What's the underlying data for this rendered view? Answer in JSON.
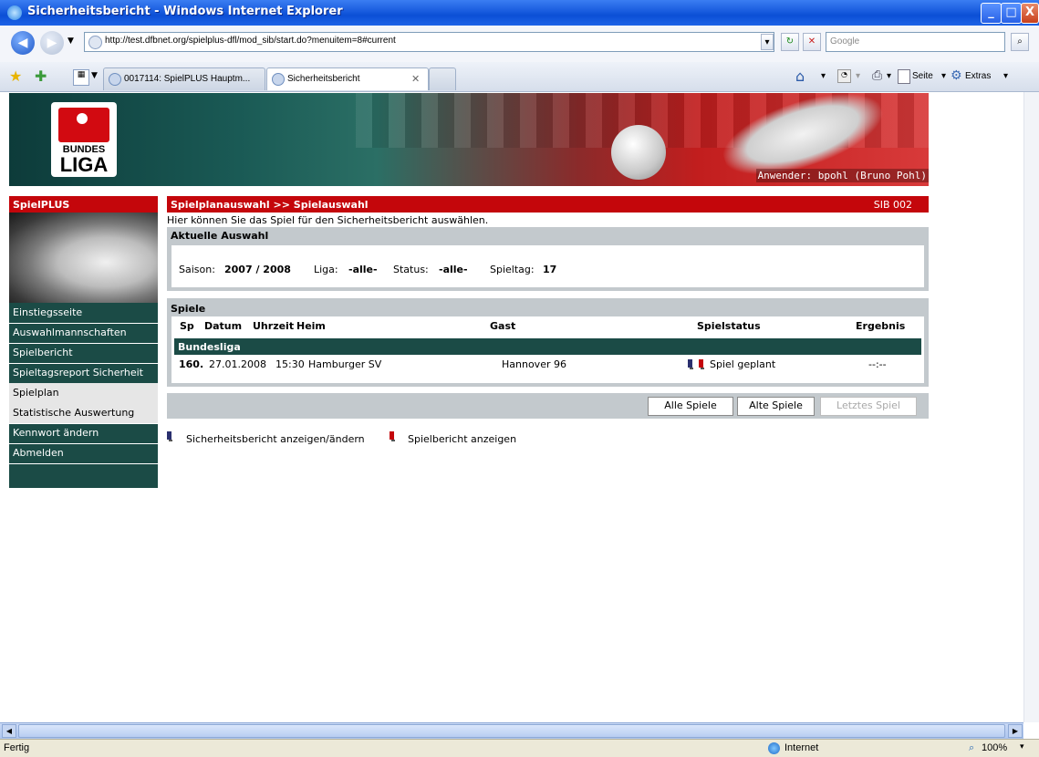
{
  "window": {
    "title": "Sicherheitsbericht - Windows Internet Explorer",
    "controls": {
      "minimize": "_",
      "maximize": "□",
      "close": "X"
    }
  },
  "addressbar": {
    "url": "http://test.dfbnet.org/spielplus-dfl/mod_sib/start.do?menuitem=8#current",
    "search_placeholder": "Google"
  },
  "tabs": [
    {
      "label": "0017114: SpielPLUS Hauptm...",
      "active": false
    },
    {
      "label": "Sicherheitsbericht",
      "active": true
    }
  ],
  "commandbar": {
    "page": "Seite",
    "extras": "Extras"
  },
  "banner": {
    "user": "Anwender: bpohl (Bruno Pohl)",
    "logo_line1": "BUNDES",
    "logo_line2": "LIGA"
  },
  "menu": {
    "title": "SpielPLUS",
    "items": [
      {
        "label": "Einstiegsseite"
      },
      {
        "label": "Auswahlmannschaften"
      },
      {
        "label": "Spielbericht"
      },
      {
        "label": "Spieltagsreport Sicherheit"
      },
      {
        "label": "Spielplan"
      },
      {
        "label": "Statistische Auswertung"
      },
      {
        "label": "Kennwort ändern"
      },
      {
        "label": "Abmelden"
      }
    ]
  },
  "content": {
    "header": "Spielplanauswahl >> Spielauswahl",
    "code": "SIB 002",
    "intro": "Hier können Sie das Spiel für den Sicherheitsbericht auswählen.",
    "auswahl": {
      "title": "Aktuelle Auswahl",
      "saison_label": "Saison:",
      "saison_value": "2007 / 2008",
      "liga_label": "Liga:",
      "liga_value": "-alle-",
      "status_label": "Status:",
      "status_value": "-alle-",
      "spieltag_label": "Spieltag:",
      "spieltag_value": "17"
    },
    "spiele": {
      "title": "Spiele",
      "columns": {
        "sp": "Sp",
        "datum": "Datum",
        "uhrzeit": "Uhrzeit",
        "heim": "Heim",
        "gast": "Gast",
        "status": "Spielstatus",
        "ergebnis": "Ergebnis"
      },
      "league": "Bundesliga",
      "rows": [
        {
          "sp": "160.",
          "datum": "27.01.2008",
          "uhrzeit": "15:30",
          "heim": "Hamburger SV",
          "gast": "Hannover 96",
          "status": "Spiel geplant",
          "ergebnis": "--:--"
        }
      ]
    },
    "buttons": {
      "alle": "Alle Spiele",
      "alte": "Alte Spiele",
      "letztes": "Letztes Spiel"
    },
    "legend": {
      "sib": "Sicherheitsbericht anzeigen/ändern",
      "spielbericht": "Spielbericht anzeigen"
    }
  },
  "statusbar": {
    "text": "Fertig",
    "zone": "Internet",
    "zoom": "100%"
  }
}
